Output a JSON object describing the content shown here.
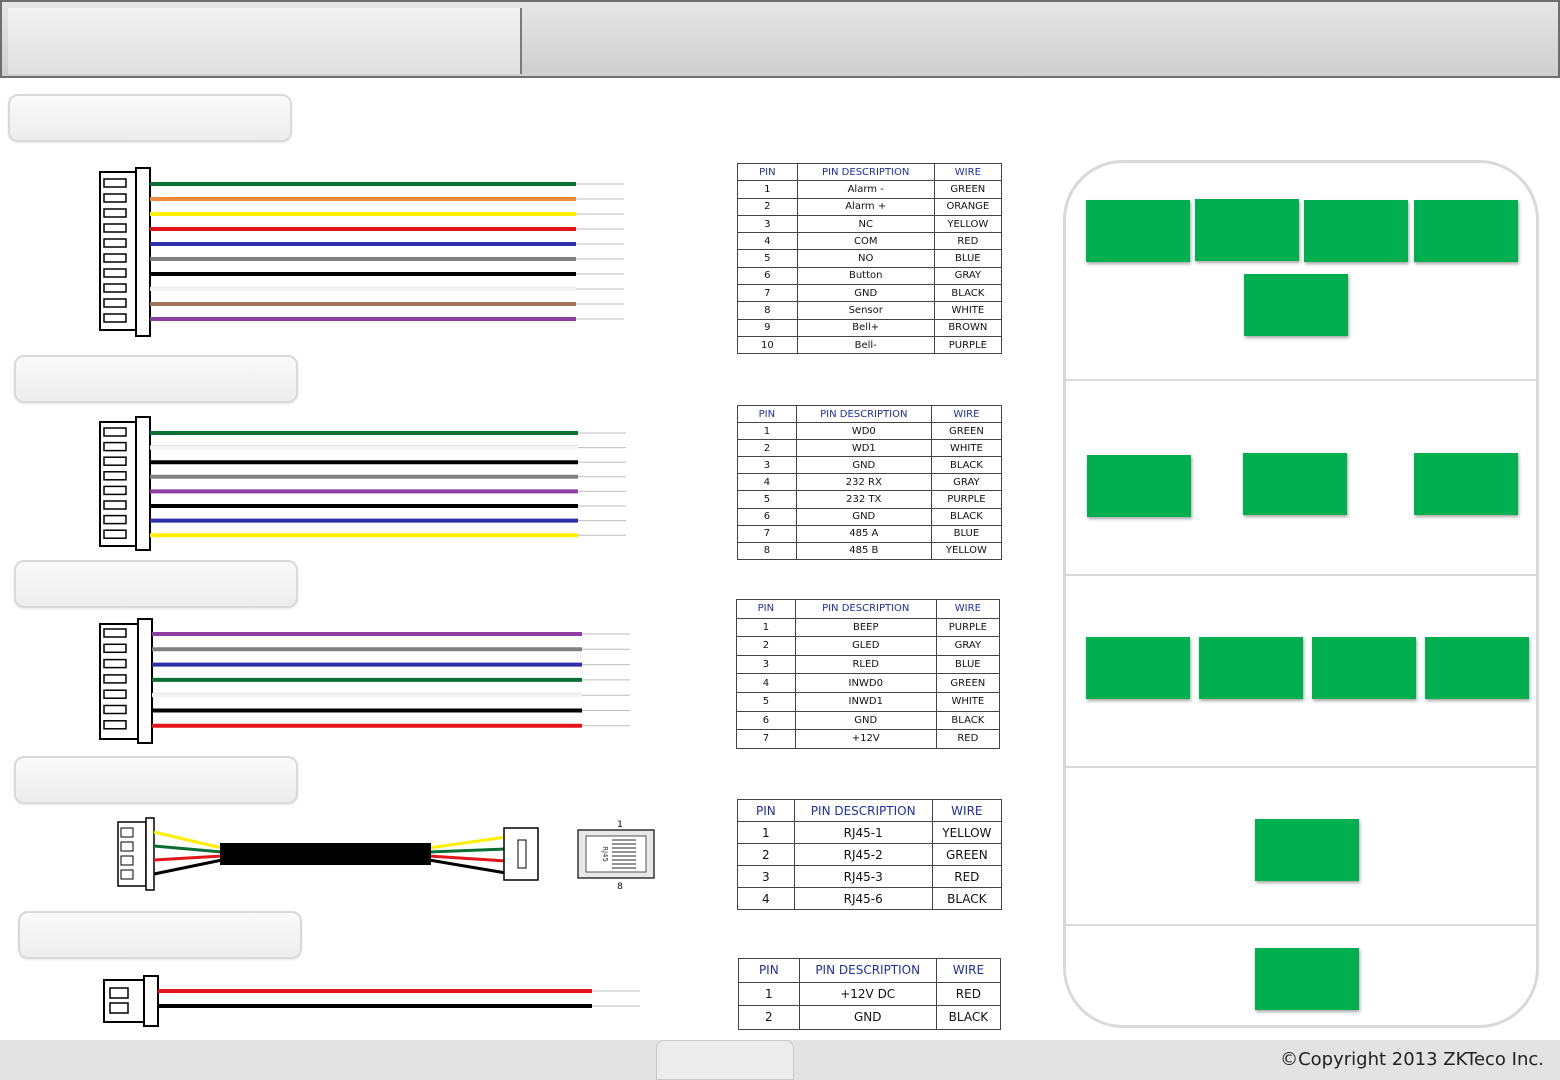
{
  "colors": {
    "GREEN": "#0b6e35",
    "ORANGE": "#f08a3c",
    "YELLOW": "#ffee00",
    "RED": "#e4141b",
    "BLUE": "#2e2ea8",
    "GRAY": "#808080",
    "BLACK": "#000000",
    "WHITE": "#f4f4f4",
    "BROWN": "#a0745a",
    "PURPLE": "#8e3da0",
    "BOX": "#00b050"
  },
  "headers": {
    "pin": "PIN",
    "desc": "PIN DESCRIPTION",
    "wire": "WIRE"
  },
  "tables": [
    {
      "rows": [
        [
          "1",
          "Alarm -",
          "GREEN"
        ],
        [
          "2",
          "Alarm +",
          "ORANGE"
        ],
        [
          "3",
          "NC",
          "YELLOW"
        ],
        [
          "4",
          "COM",
          "RED"
        ],
        [
          "5",
          "NO",
          "BLUE"
        ],
        [
          "6",
          "Button",
          "GRAY"
        ],
        [
          "7",
          "GND",
          "BLACK"
        ],
        [
          "8",
          "Sensor",
          "WHITE"
        ],
        [
          "9",
          "Bell+",
          "BROWN"
        ],
        [
          "10",
          "Bell-",
          "PURPLE"
        ]
      ]
    },
    {
      "rows": [
        [
          "1",
          "WD0",
          "GREEN"
        ],
        [
          "2",
          "WD1",
          "WHITE"
        ],
        [
          "3",
          "GND",
          "BLACK"
        ],
        [
          "4",
          "232 RX",
          "GRAY"
        ],
        [
          "5",
          "232 TX",
          "PURPLE"
        ],
        [
          "6",
          "GND",
          "BLACK"
        ],
        [
          "7",
          "485 A",
          "BLUE"
        ],
        [
          "8",
          "485 B",
          "YELLOW"
        ]
      ]
    },
    {
      "rows": [
        [
          "1",
          "BEEP",
          "PURPLE"
        ],
        [
          "2",
          "GLED",
          "GRAY"
        ],
        [
          "3",
          "RLED",
          "BLUE"
        ],
        [
          "4",
          "INWD0",
          "GREEN"
        ],
        [
          "5",
          "INWD1",
          "WHITE"
        ],
        [
          "6",
          "GND",
          "BLACK"
        ],
        [
          "7",
          "+12V",
          "RED"
        ]
      ]
    },
    {
      "rows": [
        [
          "1",
          "RJ45-1",
          "YELLOW"
        ],
        [
          "2",
          "RJ45-2",
          "GREEN"
        ],
        [
          "3",
          "RJ45-3",
          "RED"
        ],
        [
          "4",
          "RJ45-6",
          "BLACK"
        ]
      ]
    },
    {
      "rows": [
        [
          "1",
          "+12V DC",
          "RED"
        ],
        [
          "2",
          "GND",
          "BLACK"
        ]
      ]
    }
  ],
  "rj45": {
    "label": "RJ45",
    "pin_top": "1",
    "pin_bottom": "8"
  },
  "footer": {
    "copyright": "©Copyright 2013 ZKTeco Inc."
  }
}
